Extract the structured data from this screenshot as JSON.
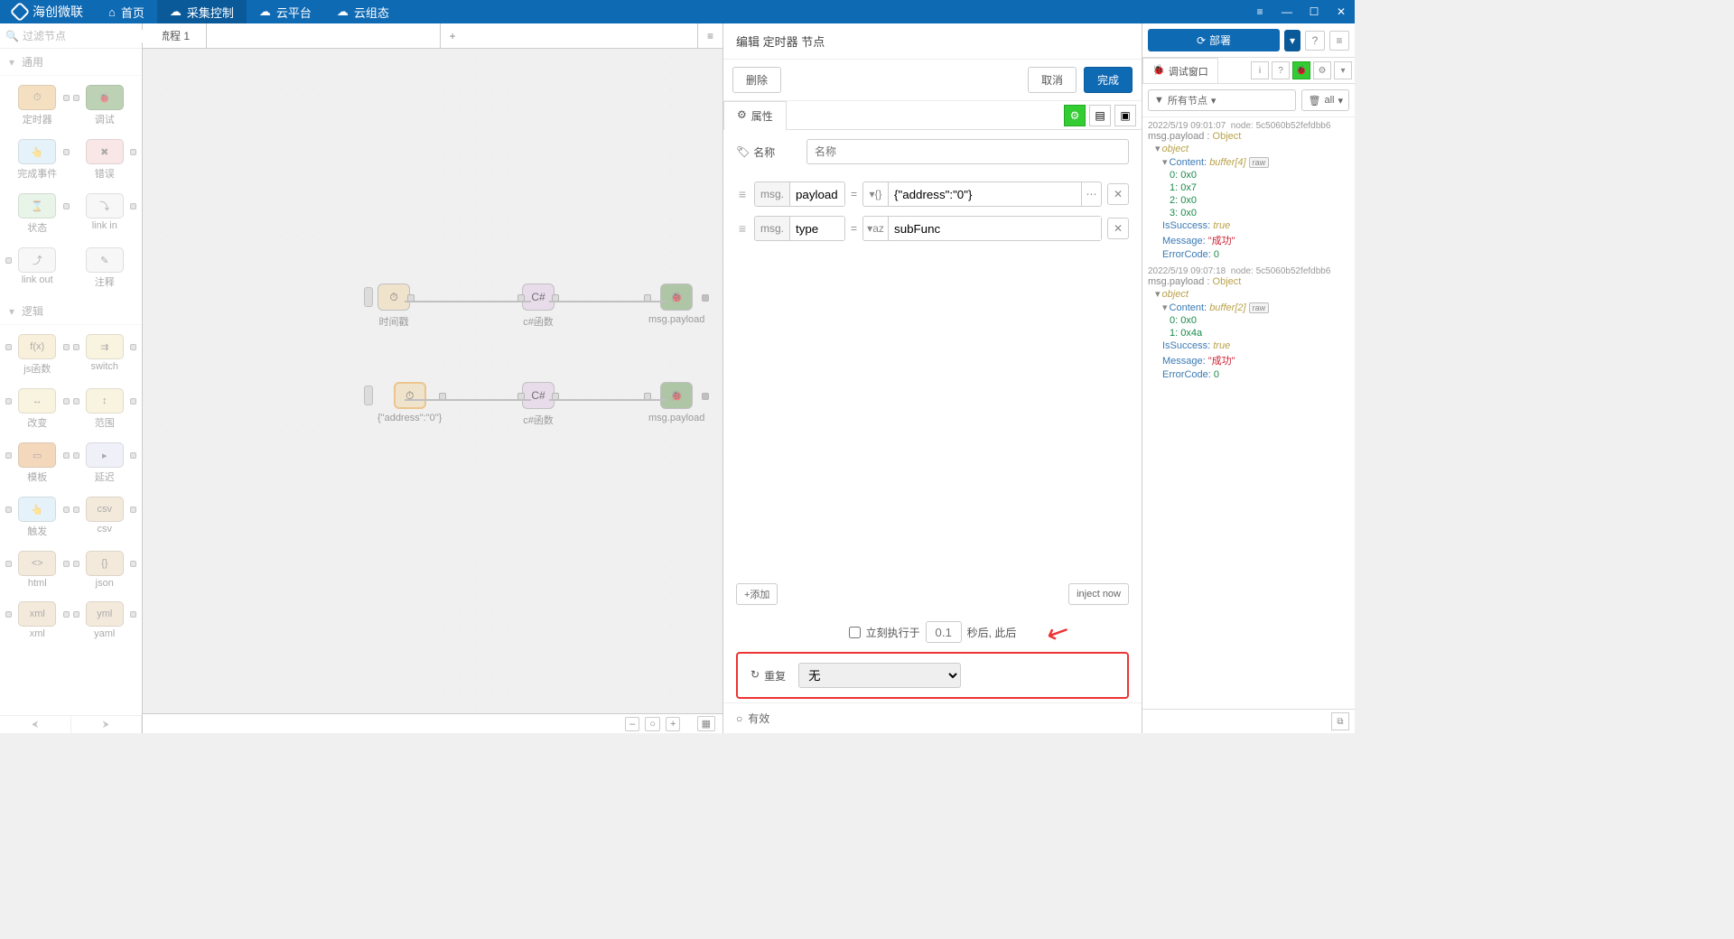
{
  "app": {
    "title": "海创微联"
  },
  "topnav": {
    "home": "首页",
    "collect": "采集控制",
    "cloud": "云平台",
    "cloudgroup": "云组态"
  },
  "palette": {
    "filter_placeholder": "过滤节点",
    "cat_general": "通用",
    "cat_logic": "逻辑",
    "nodes": {
      "timer": "定时器",
      "debug": "调试",
      "complete": "完成事件",
      "error": "错误",
      "status": "状态",
      "linkin": "link in",
      "linkout": "link out",
      "comment": "注释",
      "jsfunc": "js函数",
      "switch": "switch",
      "change": "改变",
      "range": "范围",
      "template": "模板",
      "delay": "延迟",
      "trigger": "触发",
      "csv": "csv",
      "html": "html",
      "json": "json",
      "xml": "xml",
      "yaml": "yaml"
    }
  },
  "tabs": {
    "flow1": "流程 1"
  },
  "flow": {
    "n1": "时间戳",
    "n2": "c#函数",
    "n3": "msg.payload",
    "n4": "{\"address\":\"0\"}",
    "n5": "c#函数",
    "n6": "msg.payload"
  },
  "edit": {
    "title": "编辑 定时器 节点",
    "delete": "删除",
    "cancel": "取消",
    "done": "完成",
    "tab_props": "属性",
    "label_name": "名称",
    "name_placeholder": "名称",
    "msg_prefix": "msg.",
    "r1_key": "payload",
    "r1_val": "{\"address\":\"0\"}",
    "r1_type": "{}",
    "r2_key": "type",
    "r2_val": "subFunc",
    "r2_type": "aᴢ",
    "add": "+添加",
    "inject_now": "inject now",
    "exec_label": "立刻执行于",
    "exec_placeholder": "0.1",
    "exec_suffix": "秒后, 此后",
    "repeat_label": "重复",
    "repeat_value": "无",
    "valid": "有效"
  },
  "debug": {
    "deploy": "部署",
    "window": "调试窗口",
    "filter_all_nodes": "所有节点",
    "filter_all": "all",
    "msgs": [
      {
        "time": "2022/5/19 09:01:07",
        "node": "node: 5c5060b52fefdbb6",
        "path": "msg.payload",
        "type": "Object",
        "content_label": "Content:",
        "content_type": "buffer[4]",
        "bytes": [
          "0: 0x0",
          "1: 0x7",
          "2: 0x0",
          "3: 0x0"
        ],
        "success": "IsSuccess: ",
        "success_v": "true",
        "message": "Message: ",
        "message_v": "\"成功\"",
        "errcode": "ErrorCode: ",
        "errcode_v": "0"
      },
      {
        "time": "2022/5/19 09:07:18",
        "node": "node: 5c5060b52fefdbb6",
        "path": "msg.payload",
        "type": "Object",
        "content_label": "Content:",
        "content_type": "buffer[2]",
        "bytes": [
          "0: 0x0",
          "1: 0x4a"
        ],
        "success": "IsSuccess: ",
        "success_v": "true",
        "message": "Message: ",
        "message_v": "\"成功\"",
        "errcode": "ErrorCode: ",
        "errcode_v": "0"
      }
    ],
    "object_label": "object",
    "raw": "raw"
  }
}
